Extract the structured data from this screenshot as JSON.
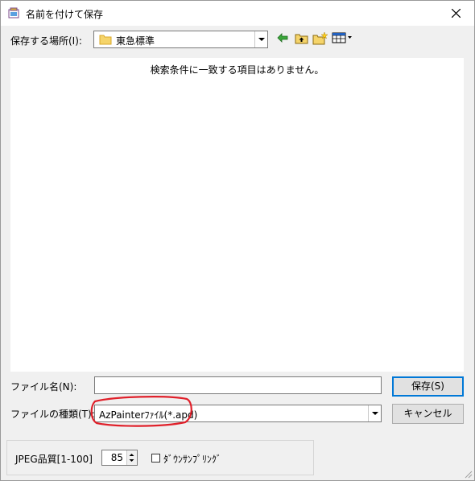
{
  "window": {
    "title": "名前を付けて保存"
  },
  "location": {
    "label": "保存する場所(I):",
    "current": "東急標準"
  },
  "listview": {
    "empty_message": "検索条件に一致する項目はありません。"
  },
  "filename": {
    "label": "ファイル名(N):",
    "value": ""
  },
  "filetype": {
    "label": "ファイルの種類(T):",
    "selected": "AzPainterﾌｧｲﾙ(*.apd)"
  },
  "buttons": {
    "save": "保存(S)",
    "cancel": "キャンセル"
  },
  "options": {
    "jpeg_label": "JPEG品質[1-100]",
    "jpeg_value": "85",
    "downsampling_label": "ﾀﾞｳﾝｻﾝﾌﾟﾘﾝｸﾞ",
    "downsampling_checked": false
  },
  "annotation": {
    "color": "#e0202a"
  },
  "toolbar": {
    "back_icon": "back-arrow-icon",
    "up_icon": "up-folder-icon",
    "new_folder_icon": "new-folder-icon",
    "view_icon": "view-menu-icon"
  }
}
